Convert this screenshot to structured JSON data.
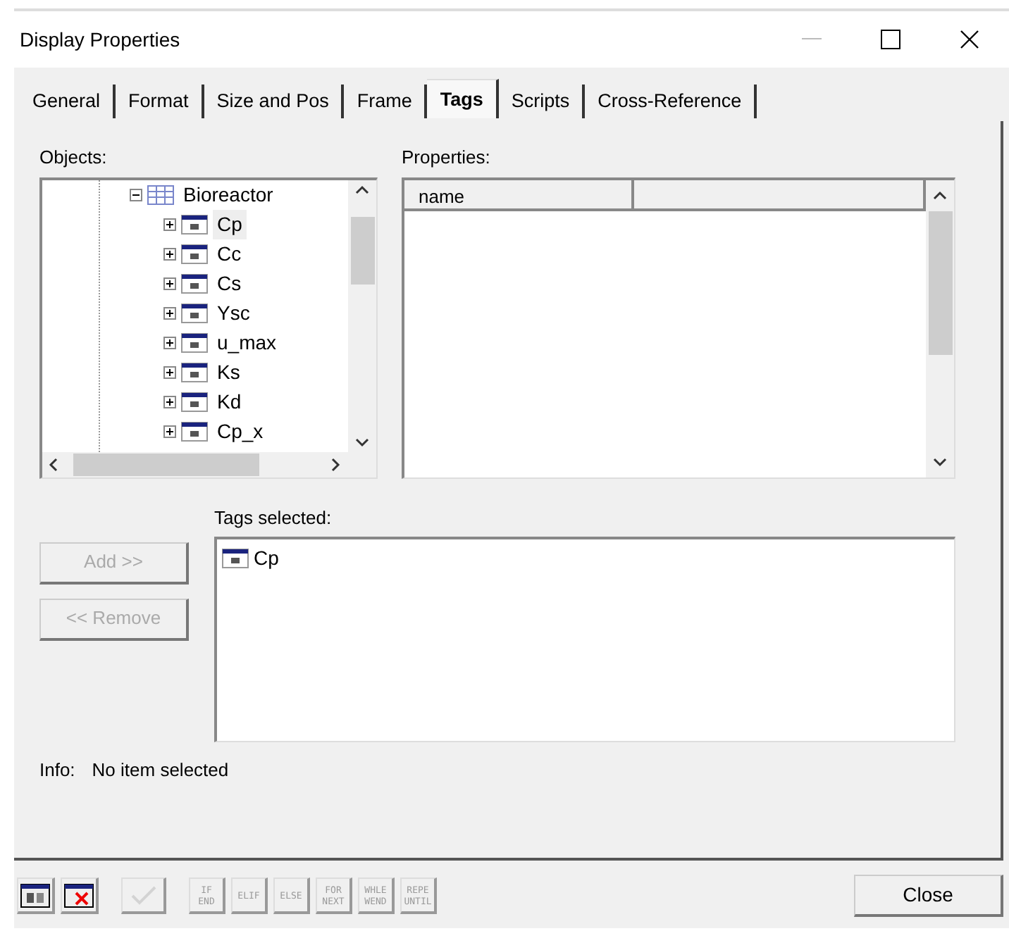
{
  "window": {
    "title": "Display Properties"
  },
  "tabs": [
    {
      "label": "General",
      "selected": false
    },
    {
      "label": "Format",
      "selected": false
    },
    {
      "label": "Size and Pos",
      "selected": false
    },
    {
      "label": "Frame",
      "selected": false
    },
    {
      "label": "Tags",
      "selected": true
    },
    {
      "label": "Scripts",
      "selected": false
    },
    {
      "label": "Cross-Reference",
      "selected": false
    }
  ],
  "objects": {
    "label": "Objects:",
    "tree": [
      {
        "label": "Bioreactor",
        "kind": "group",
        "expanded": true,
        "children": [
          {
            "label": "Cp",
            "kind": "tag",
            "expanded": false,
            "selected": true
          },
          {
            "label": "Cc",
            "kind": "tag",
            "expanded": false,
            "selected": false
          },
          {
            "label": "Cs",
            "kind": "tag",
            "expanded": false,
            "selected": false
          },
          {
            "label": "Ysc",
            "kind": "tag",
            "expanded": false,
            "selected": false
          },
          {
            "label": "u_max",
            "kind": "tag",
            "expanded": false,
            "selected": false
          },
          {
            "label": "Ks",
            "kind": "tag",
            "expanded": false,
            "selected": false
          },
          {
            "label": "Kd",
            "kind": "tag",
            "expanded": false,
            "selected": false
          },
          {
            "label": "Cp_x",
            "kind": "tag",
            "expanded": false,
            "selected": false
          }
        ]
      }
    ]
  },
  "properties": {
    "label": "Properties:",
    "columns": [
      "name",
      ""
    ]
  },
  "buttons": [
    {
      "label": "Add >>",
      "disabled": true
    },
    {
      "label": "<< Remove",
      "disabled": true
    }
  ],
  "tags_selected": {
    "label": "Tags selected:",
    "items": [
      {
        "label": "Cp"
      }
    ]
  },
  "info": {
    "label": "Info:",
    "value": "No item selected"
  },
  "toolbar": [
    {
      "kind": "window",
      "disabled": false
    },
    {
      "kind": "window-x",
      "disabled": false
    },
    {
      "kind": "check",
      "disabled": true
    },
    {
      "kind": "text",
      "lines": [
        "IF",
        "END"
      ],
      "disabled": true
    },
    {
      "kind": "text",
      "lines": [
        "ELIF"
      ],
      "disabled": true
    },
    {
      "kind": "text",
      "lines": [
        "ELSE"
      ],
      "disabled": true
    },
    {
      "kind": "text",
      "lines": [
        "FOR",
        "NEXT"
      ],
      "disabled": true
    },
    {
      "kind": "text",
      "lines": [
        "WHLE",
        "WEND"
      ],
      "disabled": true
    },
    {
      "kind": "text",
      "lines": [
        "REPE",
        "UNTIL"
      ],
      "disabled": true
    }
  ],
  "close_button": "Close"
}
